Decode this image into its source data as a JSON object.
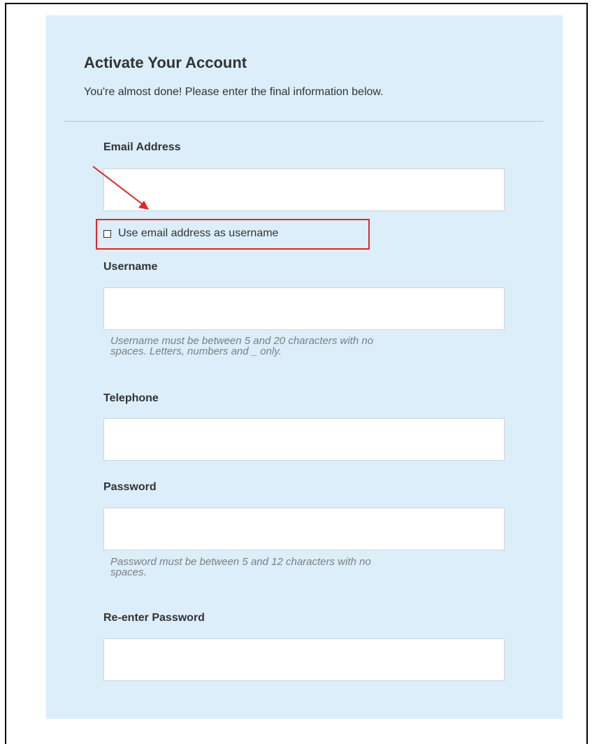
{
  "form": {
    "title": "Activate Your Account",
    "subtitle": "You're almost done! Please enter the final information below.",
    "email": {
      "label": "Email Address",
      "value": "",
      "placeholder": ""
    },
    "use_email_checkbox": {
      "label": "Use email address as username",
      "checked": false
    },
    "username": {
      "label": "Username",
      "value": "",
      "placeholder": "",
      "help_line1": "Username must be between 5 and 20 characters with no",
      "help_line2": "spaces. Letters, numbers and _ only."
    },
    "telephone": {
      "label": "Telephone",
      "value": "",
      "placeholder": ""
    },
    "password": {
      "label": "Password",
      "value": "",
      "placeholder": "",
      "help_line1": "Password must be between 5 and 12 characters with no",
      "help_line2": "spaces."
    },
    "reenter_password": {
      "label": "Re-enter Password",
      "value": "",
      "placeholder": ""
    }
  },
  "annotation": {
    "highlight_color": "#e0262b"
  },
  "colors": {
    "panel_background": "#dbeefa",
    "text": "#333333",
    "help_text": "#7b7f83"
  }
}
